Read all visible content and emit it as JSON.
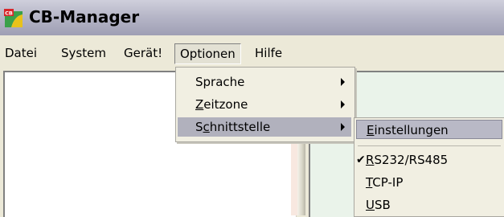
{
  "window": {
    "title": "CB-Manager",
    "logo_text": "CB"
  },
  "menubar": {
    "items": [
      {
        "label": "Datei"
      },
      {
        "label": "System"
      },
      {
        "label": "Gerät!"
      },
      {
        "label": "Optionen",
        "active": true
      },
      {
        "label": "Hilfe"
      }
    ]
  },
  "optionen_menu": {
    "items": [
      {
        "first": "S",
        "rest": "prache",
        "has_submenu": true
      },
      {
        "first": "Z",
        "rest": "eitzone",
        "has_submenu": true
      },
      {
        "pre": "S",
        "first": "c",
        "rest": "hnittstelle",
        "has_submenu": true,
        "highlighted": true
      }
    ]
  },
  "schnittstelle_submenu": {
    "items": [
      {
        "first": "E",
        "rest": "instellungen",
        "highlighted": true
      },
      {
        "first": "R",
        "rest": "S232/RS485",
        "checked": true,
        "check_glyph": "✔"
      },
      {
        "first": "T",
        "rest": "CP-IP"
      },
      {
        "first": "U",
        "rest": "SB"
      }
    ]
  },
  "colors": {
    "menu_highlight": "#b1b1bd",
    "right_panel": "#eaf3ea",
    "logo_green": "#3aa04a"
  }
}
